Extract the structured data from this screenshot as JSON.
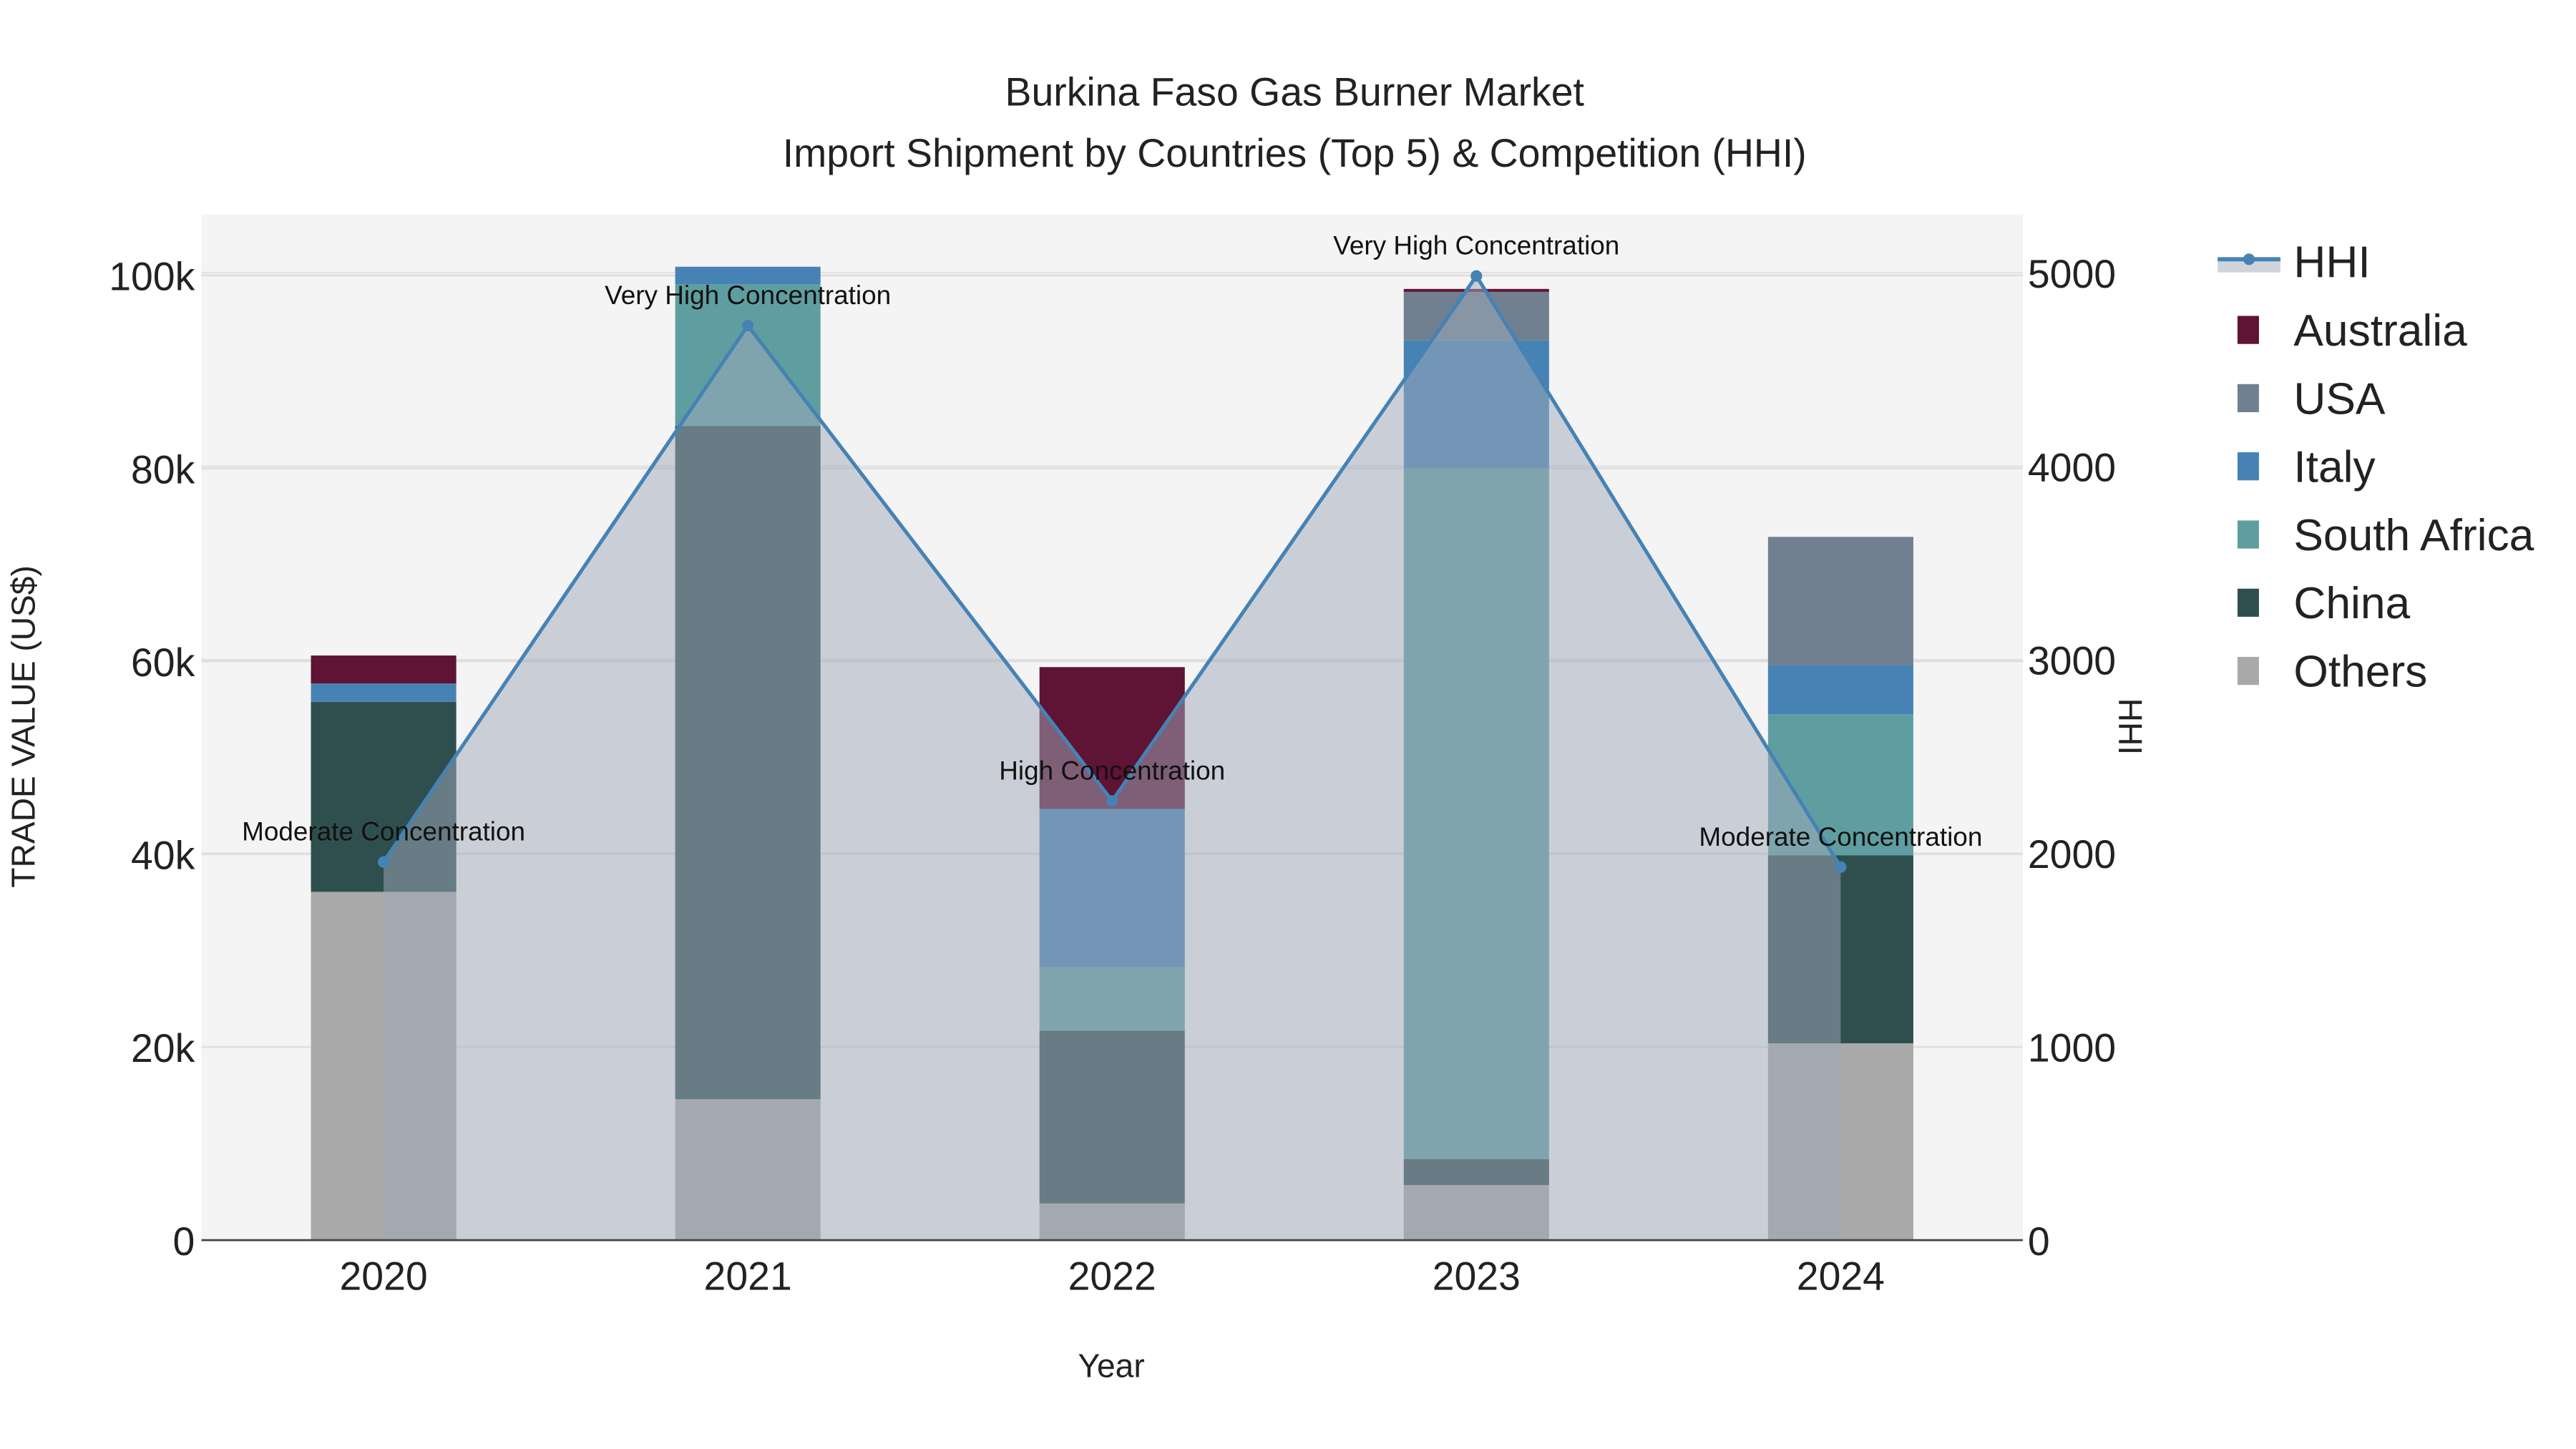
{
  "chart_data": {
    "type": "bar",
    "stacked": true,
    "title": "Burkina Faso Gas Burner Market",
    "subtitle": "Import Shipment by Countries (Top 5) & Competition (HHI)",
    "xlabel": "Year",
    "ylabel": "TRADE VALUE (US$)",
    "y2label": "HHI",
    "categories": [
      "2020",
      "2021",
      "2022",
      "2023",
      "2024"
    ],
    "ylim": [
      0,
      106300
    ],
    "y2lim": [
      0,
      5300
    ],
    "yticks": [
      0,
      20000,
      40000,
      60000,
      80000,
      100000
    ],
    "ytick_labels": [
      "0",
      "20k",
      "40k",
      "60k",
      "80k",
      "100k"
    ],
    "y2ticks": [
      0,
      1000,
      2000,
      3000,
      4000,
      5000
    ],
    "y2tick_labels": [
      "0",
      "1000",
      "2000",
      "3000",
      "4000",
      "5000"
    ],
    "grid": true,
    "legend_position": "right",
    "series": [
      {
        "name": "Others",
        "color": "#a9a9a9",
        "values": [
          36100,
          14600,
          3800,
          5700,
          20400
        ]
      },
      {
        "name": "China",
        "color": "#2f4f4f",
        "values": [
          19700,
          69800,
          17900,
          2700,
          19500
        ]
      },
      {
        "name": "South Africa",
        "color": "#5f9ea0",
        "values": [
          0,
          14700,
          6600,
          71600,
          14600
        ]
      },
      {
        "name": "Italy",
        "color": "#4682b4",
        "values": [
          1900,
          1800,
          16400,
          13300,
          5100
        ]
      },
      {
        "name": "USA",
        "color": "#708090",
        "values": [
          0,
          0,
          0,
          5000,
          13300
        ]
      },
      {
        "name": "Australia",
        "color": "#5f1335",
        "values": [
          2900,
          0,
          14700,
          300,
          0
        ]
      }
    ],
    "hhi": {
      "name": "HHI",
      "color": "#4682b4",
      "values": [
        1954,
        4727,
        2270,
        4983,
        1928
      ],
      "annotations": [
        "Moderate Concentration",
        "Very High Concentration",
        "High Concentration",
        "Very High Concentration",
        "Moderate Concentration"
      ]
    },
    "legend": [
      "HHI",
      "Australia",
      "USA",
      "Italy",
      "South Africa",
      "China",
      "Others"
    ]
  }
}
